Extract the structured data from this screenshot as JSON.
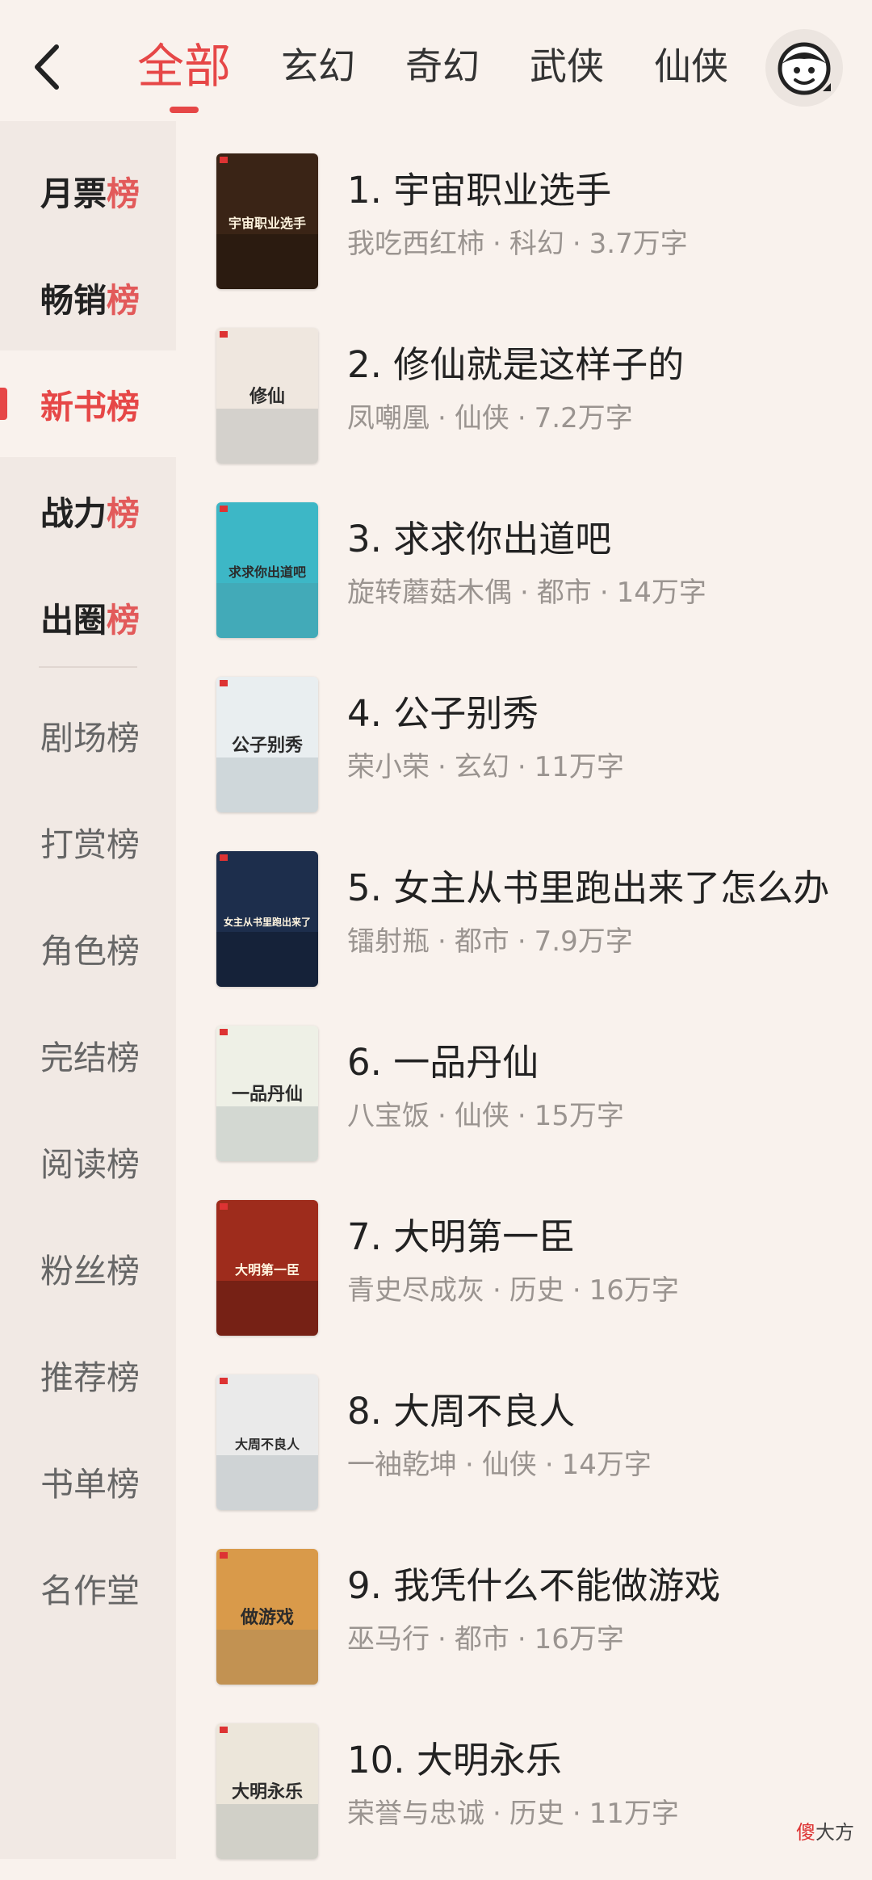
{
  "header": {
    "tabs": [
      {
        "label": "全部",
        "active": true
      },
      {
        "label": "玄幻",
        "active": false
      },
      {
        "label": "奇幻",
        "active": false
      },
      {
        "label": "武侠",
        "active": false
      },
      {
        "label": "仙侠",
        "active": false
      }
    ]
  },
  "sidebar": {
    "hot_items": [
      {
        "main": "月票",
        "hl": "榜"
      },
      {
        "main": "畅销",
        "hl": "榜"
      },
      {
        "main": "新书",
        "hl": "榜",
        "active": true
      },
      {
        "main": "战力",
        "hl": "榜"
      },
      {
        "main": "出圈",
        "hl": "榜"
      }
    ],
    "items": [
      "剧场榜",
      "打赏榜",
      "角色榜",
      "完结榜",
      "阅读榜",
      "粉丝榜",
      "推荐榜",
      "书单榜",
      "名作堂"
    ]
  },
  "books": [
    {
      "rank": "1.",
      "title": "宇宙职业选手",
      "author": "我吃西红柿",
      "genre": "科幻",
      "words": "3.7万字",
      "cover_title": "宇宙职业选手",
      "cover_color": "#3a2416"
    },
    {
      "rank": "2.",
      "title": "修仙就是这样子的",
      "author": "凤嘲凰",
      "genre": "仙侠",
      "words": "7.2万字",
      "cover_title": "修仙",
      "cover_color": "#efe7df"
    },
    {
      "rank": "3.",
      "title": "求求你出道吧",
      "author": "旋转蘑菇木偶",
      "genre": "都市",
      "words": "14万字",
      "cover_title": "求求你出道吧",
      "cover_color": "#3db7c6"
    },
    {
      "rank": "4.",
      "title": "公子别秀",
      "author": "荣小荣",
      "genre": "玄幻",
      "words": "11万字",
      "cover_title": "公子别秀",
      "cover_color": "#e9eef0"
    },
    {
      "rank": "5.",
      "title": "女主从书里跑出来了怎么办",
      "author": "镭射瓶",
      "genre": "都市",
      "words": "7.9万字",
      "cover_title": "女主从书里跑出来了",
      "cover_color": "#1d2e4c"
    },
    {
      "rank": "6.",
      "title": "一品丹仙",
      "author": "八宝饭",
      "genre": "仙侠",
      "words": "15万字",
      "cover_title": "一品丹仙",
      "cover_color": "#eef0e6"
    },
    {
      "rank": "7.",
      "title": "大明第一臣",
      "author": "青史尽成灰",
      "genre": "历史",
      "words": "16万字",
      "cover_title": "大明第一臣",
      "cover_color": "#9e2c1c"
    },
    {
      "rank": "8.",
      "title": "大周不良人",
      "author": "一袖乾坤",
      "genre": "仙侠",
      "words": "14万字",
      "cover_title": "大周不良人",
      "cover_color": "#eaeaea"
    },
    {
      "rank": "9.",
      "title": "我凭什么不能做游戏",
      "author": "巫马行",
      "genre": "都市",
      "words": "16万字",
      "cover_title": "做游戏",
      "cover_color": "#d99a4a"
    },
    {
      "rank": "10.",
      "title": "大明永乐",
      "author": "荣誉与忠诚",
      "genre": "历史",
      "words": "11万字",
      "cover_title": "大明永乐",
      "cover_color": "#ece6da"
    }
  ],
  "watermark": {
    "red": "傻",
    "rest": "大方"
  }
}
